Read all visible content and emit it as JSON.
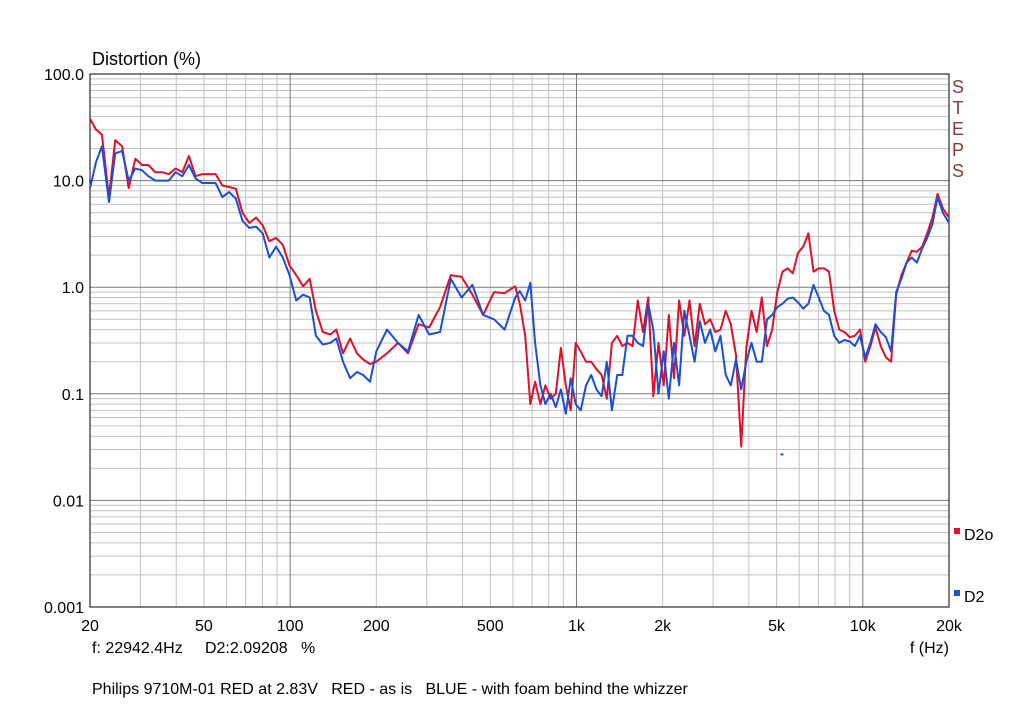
{
  "chart_data": {
    "type": "line",
    "title": "Distortion (%)",
    "xlabel": "f (Hz)",
    "x_scale": "log",
    "y_scale": "log",
    "xlim": [
      20,
      20000
    ],
    "ylim": [
      0.001,
      100
    ],
    "grid": true,
    "x_ticks": [
      {
        "value": 20,
        "label": "20"
      },
      {
        "value": 50,
        "label": "50"
      },
      {
        "value": 100,
        "label": "100"
      },
      {
        "value": 200,
        "label": "200"
      },
      {
        "value": 500,
        "label": "500"
      },
      {
        "value": 1000,
        "label": "1k"
      },
      {
        "value": 2000,
        "label": "2k"
      },
      {
        "value": 5000,
        "label": "5k"
      },
      {
        "value": 10000,
        "label": "10k"
      },
      {
        "value": 20000,
        "label": "20k"
      }
    ],
    "y_ticks": [
      {
        "value": 100,
        "label": "100.0"
      },
      {
        "value": 10,
        "label": "10.0"
      },
      {
        "value": 1,
        "label": "1.0"
      },
      {
        "value": 0.1,
        "label": "0.1"
      },
      {
        "value": 0.01,
        "label": "0.01"
      },
      {
        "value": 0.001,
        "label": "0.001"
      }
    ],
    "side_label": "STEPS",
    "cursor_readout": "f: 22942.4Hz     D2:2.09208   %",
    "legend_position": "right",
    "series": [
      {
        "name": "D2o",
        "color": "#e0102a",
        "points": [
          [
            20,
            38
          ],
          [
            21,
            30
          ],
          [
            22,
            27
          ],
          [
            23.3,
            7
          ],
          [
            24.5,
            24
          ],
          [
            25.9,
            21
          ],
          [
            27.3,
            8.5
          ],
          [
            28.8,
            16
          ],
          [
            30.4,
            14
          ],
          [
            32,
            14
          ],
          [
            33.8,
            12
          ],
          [
            35.7,
            12
          ],
          [
            37.7,
            11.5
          ],
          [
            39.8,
            13
          ],
          [
            42,
            12
          ],
          [
            44.3,
            17
          ],
          [
            46.7,
            11
          ],
          [
            49.3,
            11.5
          ],
          [
            52,
            11.5
          ],
          [
            54.9,
            11.5
          ],
          [
            58,
            9
          ],
          [
            61.2,
            8.7
          ],
          [
            64.6,
            8.4
          ],
          [
            68.2,
            5
          ],
          [
            72,
            4
          ],
          [
            76,
            4.5
          ],
          [
            80.2,
            3.8
          ],
          [
            84.6,
            2.7
          ],
          [
            89.3,
            2.9
          ],
          [
            94.3,
            2.5
          ],
          [
            99.5,
            1.6
          ],
          [
            105,
            1.3
          ],
          [
            111,
            1.02
          ],
          [
            117,
            1.2
          ],
          [
            123,
            0.6
          ],
          [
            130,
            0.38
          ],
          [
            138,
            0.36
          ],
          [
            145,
            0.4
          ],
          [
            153,
            0.24
          ],
          [
            162,
            0.33
          ],
          [
            171,
            0.24
          ],
          [
            180,
            0.21
          ],
          [
            190,
            0.19
          ],
          [
            200,
            0.2
          ],
          [
            218,
            0.24
          ],
          [
            238,
            0.3
          ],
          [
            258,
            0.24
          ],
          [
            281,
            0.45
          ],
          [
            306,
            0.42
          ],
          [
            334,
            0.65
          ],
          [
            364,
            1.3
          ],
          [
            397,
            1.25
          ],
          [
            433,
            0.85
          ],
          [
            472,
            0.55
          ],
          [
            515,
            0.9
          ],
          [
            561,
            0.88
          ],
          [
            611,
            1.02
          ],
          [
            634,
            0.7
          ],
          [
            662,
            0.35
          ],
          [
            690,
            0.08
          ],
          [
            717,
            0.13
          ],
          [
            748,
            0.08
          ],
          [
            779,
            0.12
          ],
          [
            812,
            0.09
          ],
          [
            847,
            0.1
          ],
          [
            882,
            0.27
          ],
          [
            918,
            0.12
          ],
          [
            955,
            0.07
          ],
          [
            994,
            0.3
          ],
          [
            1035,
            0.25
          ],
          [
            1080,
            0.2
          ],
          [
            1126,
            0.2
          ],
          [
            1174,
            0.17
          ],
          [
            1224,
            0.15
          ],
          [
            1276,
            0.09
          ],
          [
            1330,
            0.3
          ],
          [
            1387,
            0.35
          ],
          [
            1446,
            0.28
          ],
          [
            1507,
            0.3
          ],
          [
            1571,
            0.28
          ],
          [
            1638,
            0.75
          ],
          [
            1707,
            0.38
          ],
          [
            1780,
            0.8
          ],
          [
            1855,
            0.095
          ],
          [
            1934,
            0.3
          ],
          [
            2016,
            0.12
          ],
          [
            2101,
            0.55
          ],
          [
            2190,
            0.14
          ],
          [
            2283,
            0.75
          ],
          [
            2380,
            0.35
          ],
          [
            2481,
            0.75
          ],
          [
            2586,
            0.28
          ],
          [
            2696,
            0.7
          ],
          [
            2810,
            0.45
          ],
          [
            2930,
            0.5
          ],
          [
            3054,
            0.38
          ],
          [
            3184,
            0.4
          ],
          [
            3319,
            0.6
          ],
          [
            3460,
            0.45
          ],
          [
            3607,
            0.23
          ],
          [
            3760,
            0.032
          ],
          [
            3919,
            0.27
          ],
          [
            4085,
            0.6
          ],
          [
            4259,
            0.38
          ],
          [
            4440,
            0.8
          ],
          [
            4628,
            0.28
          ],
          [
            4825,
            0.4
          ],
          [
            5029,
            0.9
          ],
          [
            5243,
            1.4
          ],
          [
            5465,
            1.5
          ],
          [
            5697,
            1.35
          ],
          [
            5939,
            2.1
          ],
          [
            6191,
            2.4
          ],
          [
            6454,
            3.2
          ],
          [
            6728,
            1.4
          ],
          [
            7013,
            1.5
          ],
          [
            7311,
            1.5
          ],
          [
            7621,
            1.4
          ],
          [
            7944,
            0.6
          ],
          [
            8281,
            0.4
          ],
          [
            8633,
            0.38
          ],
          [
            8999,
            0.34
          ],
          [
            9381,
            0.35
          ],
          [
            9779,
            0.4
          ],
          [
            10194,
            0.2
          ],
          [
            10627,
            0.28
          ],
          [
            11078,
            0.42
          ],
          [
            11549,
            0.28
          ],
          [
            12039,
            0.22
          ],
          [
            12550,
            0.2
          ],
          [
            13082,
            0.85
          ],
          [
            13638,
            1.3
          ],
          [
            14217,
            1.7
          ],
          [
            14821,
            2.2
          ],
          [
            15450,
            2.15
          ],
          [
            16106,
            2.4
          ],
          [
            16790,
            3.2
          ],
          [
            17503,
            4.5
          ],
          [
            18246,
            7.5
          ],
          [
            19021,
            5.5
          ],
          [
            20000,
            4.5
          ]
        ]
      },
      {
        "name": "D2",
        "color": "#1a4fd6",
        "points": [
          [
            20,
            8.5
          ],
          [
            21,
            15
          ],
          [
            22,
            21
          ],
          [
            23.3,
            6.3
          ],
          [
            24.5,
            18
          ],
          [
            25.9,
            19
          ],
          [
            27.3,
            10
          ],
          [
            28.8,
            13
          ],
          [
            30.4,
            12.5
          ],
          [
            32,
            11
          ],
          [
            33.8,
            10
          ],
          [
            35.7,
            10
          ],
          [
            37.7,
            10
          ],
          [
            39.8,
            12
          ],
          [
            42,
            11
          ],
          [
            44.3,
            14
          ],
          [
            46.7,
            10.5
          ],
          [
            49.3,
            9.5
          ],
          [
            52,
            9.5
          ],
          [
            54.9,
            9.5
          ],
          [
            58,
            7
          ],
          [
            61.2,
            7.8
          ],
          [
            64.6,
            6.8
          ],
          [
            68.2,
            4.2
          ],
          [
            72,
            3.6
          ],
          [
            76,
            3.7
          ],
          [
            80.2,
            3.2
          ],
          [
            84.6,
            1.9
          ],
          [
            89.3,
            2.4
          ],
          [
            94.3,
            1.9
          ],
          [
            99.5,
            1.3
          ],
          [
            105,
            0.75
          ],
          [
            111,
            0.85
          ],
          [
            117,
            0.8
          ],
          [
            123,
            0.35
          ],
          [
            130,
            0.29
          ],
          [
            138,
            0.3
          ],
          [
            145,
            0.33
          ],
          [
            153,
            0.2
          ],
          [
            162,
            0.14
          ],
          [
            171,
            0.16
          ],
          [
            180,
            0.15
          ],
          [
            190,
            0.13
          ],
          [
            200,
            0.25
          ],
          [
            218,
            0.4
          ],
          [
            238,
            0.3
          ],
          [
            258,
            0.25
          ],
          [
            281,
            0.55
          ],
          [
            306,
            0.36
          ],
          [
            334,
            0.38
          ],
          [
            364,
            1.2
          ],
          [
            397,
            0.8
          ],
          [
            433,
            1.05
          ],
          [
            472,
            0.55
          ],
          [
            515,
            0.5
          ],
          [
            561,
            0.4
          ],
          [
            611,
            0.8
          ],
          [
            634,
            0.92
          ],
          [
            662,
            0.75
          ],
          [
            690,
            1.1
          ],
          [
            717,
            0.3
          ],
          [
            748,
            0.12
          ],
          [
            779,
            0.08
          ],
          [
            812,
            0.1
          ],
          [
            847,
            0.075
          ],
          [
            882,
            0.11
          ],
          [
            918,
            0.065
          ],
          [
            955,
            0.14
          ],
          [
            994,
            0.08
          ],
          [
            1035,
            0.07
          ],
          [
            1080,
            0.12
          ],
          [
            1126,
            0.15
          ],
          [
            1174,
            0.11
          ],
          [
            1224,
            0.095
          ],
          [
            1276,
            0.2
          ],
          [
            1330,
            0.07
          ],
          [
            1387,
            0.15
          ],
          [
            1446,
            0.15
          ],
          [
            1507,
            0.35
          ],
          [
            1571,
            0.35
          ],
          [
            1638,
            0.3
          ],
          [
            1707,
            0.28
          ],
          [
            1780,
            0.7
          ],
          [
            1855,
            0.4
          ],
          [
            1934,
            0.1
          ],
          [
            2016,
            0.25
          ],
          [
            2101,
            0.09
          ],
          [
            2190,
            0.3
          ],
          [
            2283,
            0.12
          ],
          [
            2380,
            0.6
          ],
          [
            2481,
            0.35
          ],
          [
            2586,
            0.2
          ],
          [
            2696,
            0.48
          ],
          [
            2810,
            0.3
          ],
          [
            2930,
            0.4
          ],
          [
            3054,
            0.25
          ],
          [
            3184,
            0.35
          ],
          [
            3319,
            0.15
          ],
          [
            3460,
            0.12
          ],
          [
            3607,
            0.21
          ],
          [
            3760,
            0.11
          ],
          [
            3919,
            0.2
          ],
          [
            4085,
            0.3
          ],
          [
            4259,
            0.2
          ],
          [
            4440,
            0.2
          ],
          [
            4628,
            0.5
          ],
          [
            4825,
            0.55
          ],
          [
            5029,
            0.65
          ],
          [
            5243,
            0.7
          ],
          [
            5465,
            0.78
          ],
          [
            5697,
            0.8
          ],
          [
            5939,
            0.72
          ],
          [
            6191,
            0.63
          ],
          [
            6454,
            0.7
          ],
          [
            6728,
            1.05
          ],
          [
            7013,
            0.8
          ],
          [
            7311,
            0.6
          ],
          [
            7621,
            0.55
          ],
          [
            7944,
            0.35
          ],
          [
            8281,
            0.3
          ],
          [
            8633,
            0.32
          ],
          [
            8999,
            0.31
          ],
          [
            9381,
            0.28
          ],
          [
            9779,
            0.35
          ],
          [
            10194,
            0.22
          ],
          [
            10627,
            0.3
          ],
          [
            11078,
            0.45
          ],
          [
            11549,
            0.38
          ],
          [
            12039,
            0.34
          ],
          [
            12550,
            0.25
          ],
          [
            13082,
            0.9
          ],
          [
            13638,
            1.2
          ],
          [
            14217,
            1.7
          ],
          [
            14821,
            1.9
          ],
          [
            15450,
            1.7
          ],
          [
            16106,
            2.3
          ],
          [
            16790,
            2.9
          ],
          [
            17503,
            3.9
          ],
          [
            18246,
            7.0
          ],
          [
            19021,
            5.0
          ],
          [
            20000,
            4.0
          ]
        ]
      }
    ],
    "stray_points": [
      {
        "color": "#1a4fd6",
        "x": 5200,
        "y": 0.027
      }
    ]
  },
  "caption": "Philips 9710M-01 RED at 2.83V   RED - as is   BLUE - with foam behind the whizzer"
}
